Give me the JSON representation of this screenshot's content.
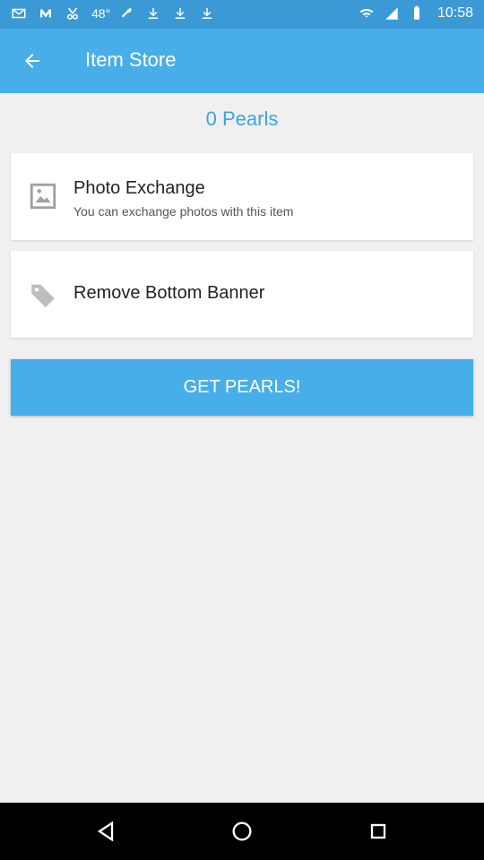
{
  "status_bar": {
    "time": "10:58",
    "left_icons": [
      "mail-icon",
      "m-icon",
      "cut-icon",
      "48-icon",
      "wrench-icon",
      "download-icon",
      "download-icon",
      "download-icon"
    ],
    "right_icons": [
      "wifi-icon",
      "signal-icon",
      "battery-icon"
    ],
    "badge_48": "48°"
  },
  "app_bar": {
    "title": "Item Store"
  },
  "balance": {
    "text": "0 Pearls"
  },
  "items": [
    {
      "title": "Photo Exchange",
      "subtitle": "You can exchange photos with this item",
      "icon": "image-icon"
    },
    {
      "title": "Remove Bottom Banner",
      "subtitle": "",
      "icon": "tag-icon"
    }
  ],
  "actions": {
    "get_pearls": "GET PEARLS!"
  },
  "colors": {
    "app_bar": "#47aee9",
    "status_bar": "#3b9ad6",
    "accent_text": "#3ba3e6",
    "background": "#f0f0f0"
  },
  "nav": {
    "buttons": [
      "back-icon",
      "home-icon",
      "recents-icon"
    ]
  }
}
